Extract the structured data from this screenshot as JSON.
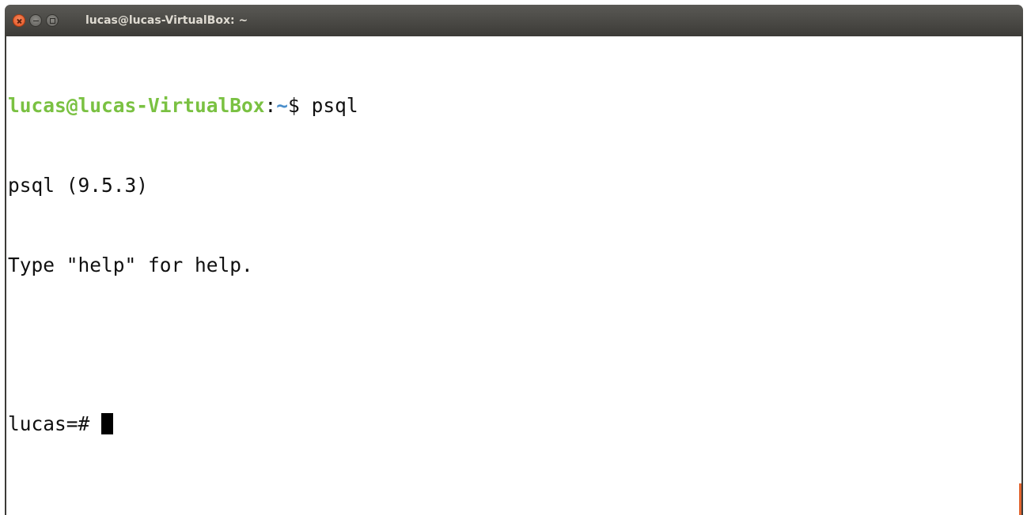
{
  "window": {
    "title": "lucas@lucas-VirtualBox: ~"
  },
  "terminal": {
    "prompt_user_host": "lucas@lucas-VirtualBox",
    "prompt_colon": ":",
    "prompt_path": "~",
    "prompt_dollar": "$ ",
    "command": "psql",
    "output_line_1": "psql (9.5.3)",
    "output_line_2": "Type \"help\" for help.",
    "psql_prompt": "lucas=# "
  },
  "colors": {
    "prompt_user_host": "#7ac142",
    "prompt_path": "#4a8ecb",
    "close_button": "#e3501f",
    "titlebar": "#3c3b37"
  },
  "icons": [
    "close-icon",
    "minimize-icon",
    "maximize-icon"
  ]
}
